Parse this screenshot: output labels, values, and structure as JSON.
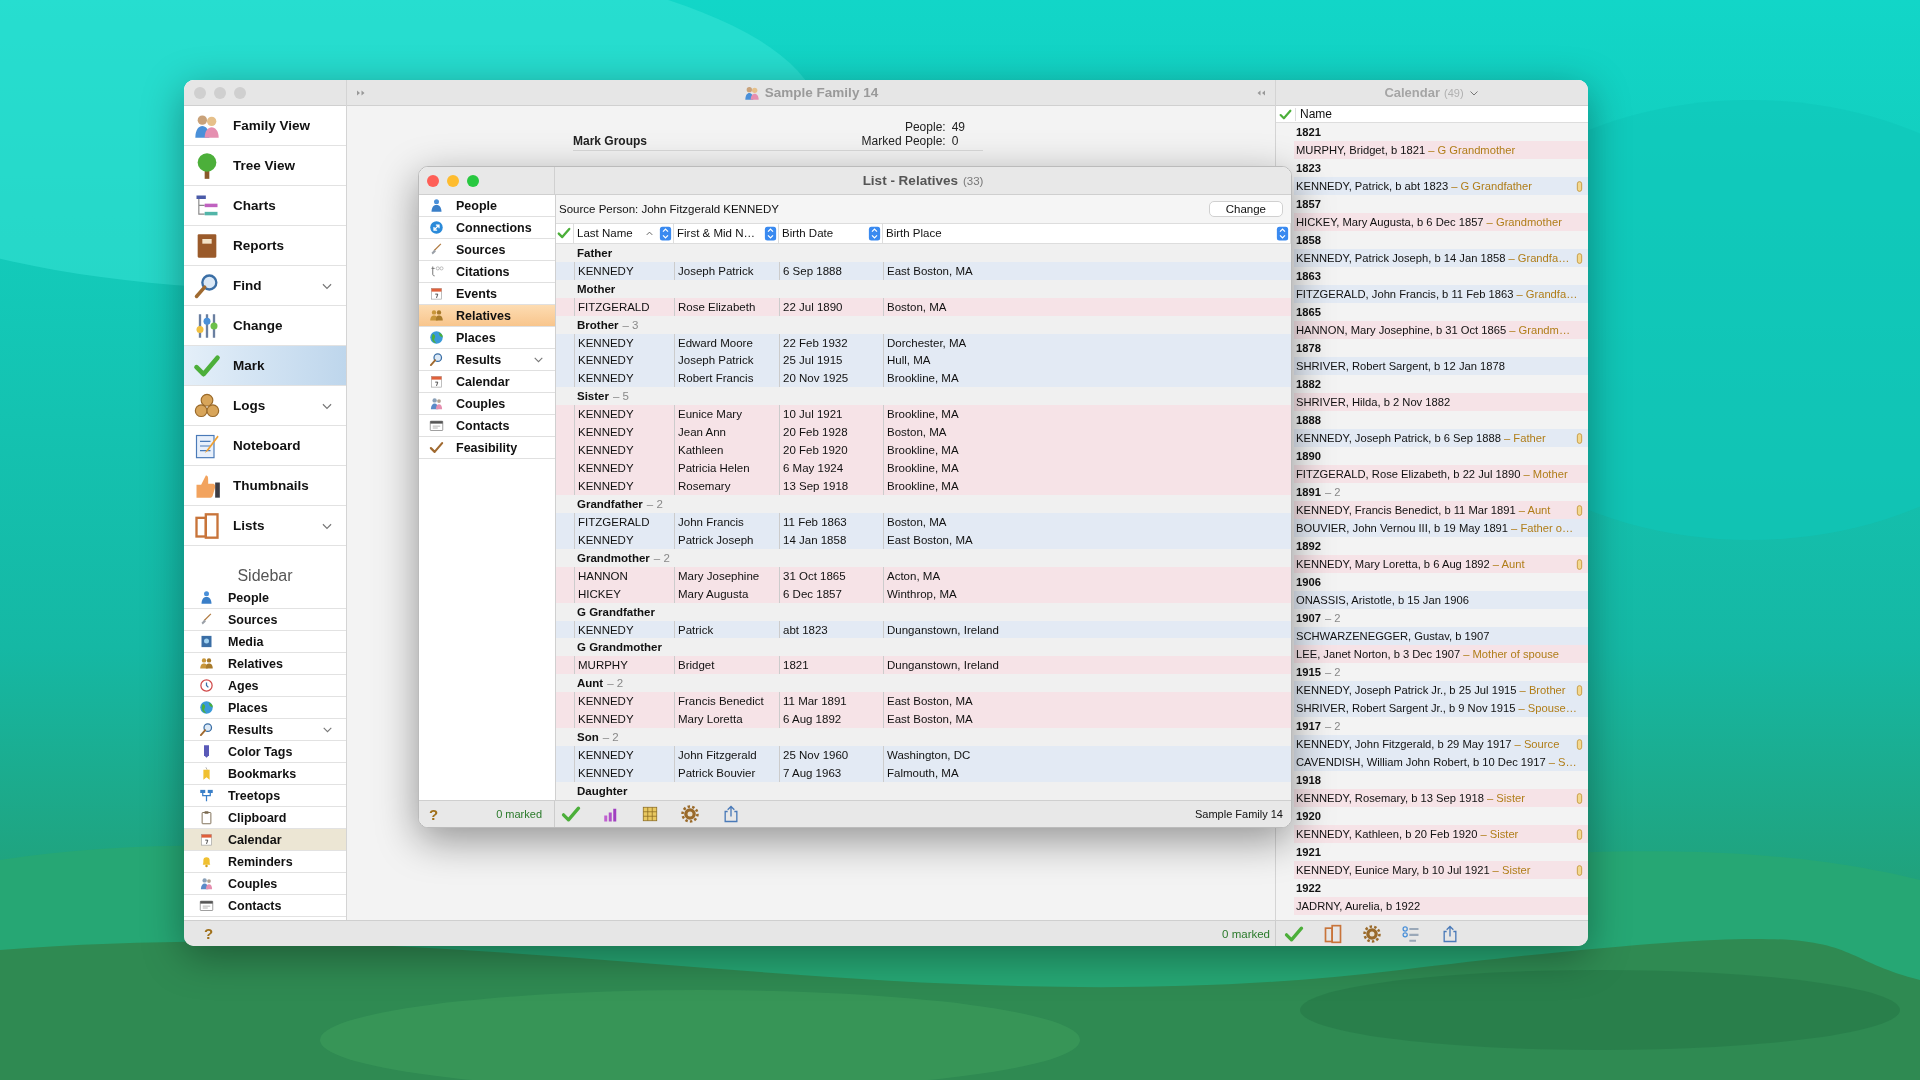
{
  "window": {
    "title": "Sample Family 14"
  },
  "nav": {
    "items": [
      {
        "label": "Family View",
        "selected": false,
        "expandable": false
      },
      {
        "label": "Tree View",
        "selected": false,
        "expandable": false
      },
      {
        "label": "Charts",
        "selected": false,
        "expandable": false
      },
      {
        "label": "Reports",
        "selected": false,
        "expandable": false
      },
      {
        "label": "Find",
        "selected": false,
        "expandable": true
      },
      {
        "label": "Change",
        "selected": false,
        "expandable": false
      },
      {
        "label": "Mark",
        "selected": true,
        "expandable": false
      },
      {
        "label": "Logs",
        "selected": false,
        "expandable": true
      },
      {
        "label": "Noteboard",
        "selected": false,
        "expandable": false
      },
      {
        "label": "Thumbnails",
        "selected": false,
        "expandable": false
      },
      {
        "label": "Lists",
        "selected": false,
        "expandable": true
      }
    ]
  },
  "sidebar": {
    "heading": "Sidebar",
    "items": [
      {
        "label": "People",
        "selected": false,
        "expandable": false
      },
      {
        "label": "Sources",
        "selected": false,
        "expandable": false
      },
      {
        "label": "Media",
        "selected": false,
        "expandable": false
      },
      {
        "label": "Relatives",
        "selected": false,
        "expandable": false
      },
      {
        "label": "Ages",
        "selected": false,
        "expandable": false
      },
      {
        "label": "Places",
        "selected": false,
        "expandable": false
      },
      {
        "label": "Results",
        "selected": false,
        "expandable": true
      },
      {
        "label": "Color Tags",
        "selected": false,
        "expandable": false
      },
      {
        "label": "Bookmarks",
        "selected": false,
        "expandable": false
      },
      {
        "label": "Treetops",
        "selected": false,
        "expandable": false
      },
      {
        "label": "Clipboard",
        "selected": false,
        "expandable": false
      },
      {
        "label": "Calendar",
        "selected": true,
        "expandable": false
      },
      {
        "label": "Reminders",
        "selected": false,
        "expandable": false
      },
      {
        "label": "Couples",
        "selected": false,
        "expandable": false
      },
      {
        "label": "Contacts",
        "selected": false,
        "expandable": false
      }
    ]
  },
  "mark_summary": {
    "heading": "Mark Groups",
    "stats": [
      {
        "label": "People:",
        "value": "49"
      },
      {
        "label": "Marked People:",
        "value": "0"
      }
    ]
  },
  "list_window": {
    "title": "List - Relatives",
    "count": "(33)",
    "menu": [
      {
        "label": "People",
        "selected": false,
        "expandable": false
      },
      {
        "label": "Connections",
        "selected": false,
        "expandable": false
      },
      {
        "label": "Sources",
        "selected": false,
        "expandable": false
      },
      {
        "label": "Citations",
        "selected": false,
        "expandable": false
      },
      {
        "label": "Events",
        "selected": false,
        "expandable": false
      },
      {
        "label": "Relatives",
        "selected": true,
        "expandable": false
      },
      {
        "label": "Places",
        "selected": false,
        "expandable": false
      },
      {
        "label": "Results",
        "selected": false,
        "expandable": true
      },
      {
        "label": "Calendar",
        "selected": false,
        "expandable": false
      },
      {
        "label": "Couples",
        "selected": false,
        "expandable": false
      },
      {
        "label": "Contacts",
        "selected": false,
        "expandable": false
      },
      {
        "label": "Feasibility",
        "selected": false,
        "expandable": false
      }
    ],
    "source_person": "Source Person: John Fitzgerald KENNEDY",
    "change_button": "Change",
    "columns": [
      {
        "label": "Last Name",
        "sorted": true
      },
      {
        "label": "First & Mid N…",
        "sorted": false
      },
      {
        "label": "Birth Date",
        "sorted": false
      },
      {
        "label": "Birth Place",
        "sorted": false
      }
    ],
    "rows": [
      {
        "kind": "group",
        "label": "Father"
      },
      {
        "kind": "person",
        "color": "#e3eaf4",
        "cells": [
          "KENNEDY",
          "Joseph Patrick",
          "6 Sep 1888",
          "East Boston, MA"
        ]
      },
      {
        "kind": "group",
        "label": "Mother"
      },
      {
        "kind": "person",
        "color": "#f6e3e7",
        "cells": [
          "FITZGERALD",
          "Rose Elizabeth",
          "22 Jul 1890",
          "Boston, MA"
        ]
      },
      {
        "kind": "group",
        "label": "Brother",
        "count": "– 3"
      },
      {
        "kind": "person",
        "color": "#e3eaf4",
        "cells": [
          "KENNEDY",
          "Edward Moore",
          "22 Feb 1932",
          "Dorchester, MA"
        ]
      },
      {
        "kind": "person",
        "color": "#e3eaf4",
        "cells": [
          "KENNEDY",
          "Joseph Patrick",
          "25 Jul 1915",
          "Hull, MA"
        ]
      },
      {
        "kind": "person",
        "color": "#e3eaf4",
        "cells": [
          "KENNEDY",
          "Robert Francis",
          "20 Nov 1925",
          "Brookline, MA"
        ]
      },
      {
        "kind": "group",
        "label": "Sister",
        "count": "– 5"
      },
      {
        "kind": "person",
        "color": "#f6e3e7",
        "cells": [
          "KENNEDY",
          "Eunice Mary",
          "10 Jul 1921",
          "Brookline, MA"
        ]
      },
      {
        "kind": "person",
        "color": "#f6e3e7",
        "cells": [
          "KENNEDY",
          "Jean Ann",
          "20 Feb 1928",
          "Boston, MA"
        ]
      },
      {
        "kind": "person",
        "color": "#f6e3e7",
        "cells": [
          "KENNEDY",
          "Kathleen",
          "20 Feb 1920",
          "Brookline, MA"
        ]
      },
      {
        "kind": "person",
        "color": "#f6e3e7",
        "cells": [
          "KENNEDY",
          "Patricia Helen",
          "6 May 1924",
          "Brookline, MA"
        ]
      },
      {
        "kind": "person",
        "color": "#f6e3e7",
        "cells": [
          "KENNEDY",
          "Rosemary",
          "13 Sep 1918",
          "Brookline, MA"
        ]
      },
      {
        "kind": "group",
        "label": "Grandfather",
        "count": "– 2"
      },
      {
        "kind": "person",
        "color": "#e3eaf4",
        "cells": [
          "FITZGERALD",
          "John Francis",
          "11 Feb 1863",
          "Boston, MA"
        ]
      },
      {
        "kind": "person",
        "color": "#e3eaf4",
        "cells": [
          "KENNEDY",
          "Patrick Joseph",
          "14 Jan 1858",
          "East Boston, MA"
        ]
      },
      {
        "kind": "group",
        "label": "Grandmother",
        "count": "– 2"
      },
      {
        "kind": "person",
        "color": "#f6e3e7",
        "cells": [
          "HANNON",
          "Mary Josephine",
          "31 Oct 1865",
          "Acton, MA"
        ]
      },
      {
        "kind": "person",
        "color": "#f6e3e7",
        "cells": [
          "HICKEY",
          "Mary Augusta",
          "6 Dec 1857",
          "Winthrop, MA"
        ]
      },
      {
        "kind": "group",
        "label": "G Grandfather"
      },
      {
        "kind": "person",
        "color": "#e3eaf4",
        "cells": [
          "KENNEDY",
          "Patrick",
          "abt 1823",
          "Dunganstown, Ireland"
        ]
      },
      {
        "kind": "group",
        "label": "G Grandmother"
      },
      {
        "kind": "person",
        "color": "#f6e3e7",
        "cells": [
          "MURPHY",
          "Bridget",
          "1821",
          "Dunganstown, Ireland"
        ]
      },
      {
        "kind": "group",
        "label": "Aunt",
        "count": "– 2"
      },
      {
        "kind": "person",
        "color": "#f6e3e7",
        "cells": [
          "KENNEDY",
          "Francis Benedict",
          "11 Mar 1891",
          "East Boston, MA"
        ]
      },
      {
        "kind": "person",
        "color": "#f6e3e7",
        "cells": [
          "KENNEDY",
          "Mary Loretta",
          "6 Aug 1892",
          "East Boston, MA"
        ]
      },
      {
        "kind": "group",
        "label": "Son",
        "count": "– 2"
      },
      {
        "kind": "person",
        "color": "#e3eaf4",
        "cells": [
          "KENNEDY",
          "John Fitzgerald",
          "25 Nov 1960",
          "Washington, DC"
        ]
      },
      {
        "kind": "person",
        "color": "#e3eaf4",
        "cells": [
          "KENNEDY",
          "Patrick Bouvier",
          "7 Aug 1963",
          "Falmouth, MA"
        ]
      },
      {
        "kind": "group",
        "label": "Daughter"
      }
    ],
    "footer": {
      "help": "?",
      "marked": "0 marked",
      "file": "Sample Family 14"
    }
  },
  "calendar": {
    "title": "Calendar",
    "count": "(49)",
    "column": "Name",
    "rows": [
      {
        "kind": "year",
        "label": "1821"
      },
      {
        "kind": "person",
        "color": "#f6e3e7",
        "text": "MURPHY, Bridget, b 1821",
        "relation": "– G Grandmother",
        "tagged": false
      },
      {
        "kind": "year",
        "label": "1823"
      },
      {
        "kind": "person",
        "color": "#e3eaf4",
        "text": "KENNEDY, Patrick, b abt 1823",
        "relation": "– G Grandfather",
        "tagged": true
      },
      {
        "kind": "year",
        "label": "1857"
      },
      {
        "kind": "person",
        "color": "#f6e3e7",
        "text": "HICKEY, Mary Augusta, b 6 Dec 1857",
        "relation": "– Grandmother",
        "tagged": false
      },
      {
        "kind": "year",
        "label": "1858"
      },
      {
        "kind": "person",
        "color": "#e3eaf4",
        "text": "KENNEDY, Patrick Joseph, b 14 Jan 1858",
        "relation": "– Grandfa…",
        "tagged": true
      },
      {
        "kind": "year",
        "label": "1863"
      },
      {
        "kind": "person",
        "color": "#e3eaf4",
        "text": "FITZGERALD, John Francis, b 11 Feb 1863",
        "relation": "– Grandfa…",
        "tagged": false
      },
      {
        "kind": "year",
        "label": "1865"
      },
      {
        "kind": "person",
        "color": "#f6e3e7",
        "text": "HANNON, Mary Josephine, b 31 Oct 1865",
        "relation": "– Grandm…",
        "tagged": false
      },
      {
        "kind": "year",
        "label": "1878"
      },
      {
        "kind": "person",
        "color": "#e3eaf4",
        "text": "SHRIVER, Robert Sargent, b 12 Jan 1878",
        "tagged": false
      },
      {
        "kind": "year",
        "label": "1882"
      },
      {
        "kind": "person",
        "color": "#f6e3e7",
        "text": "SHRIVER, Hilda, b 2 Nov 1882",
        "tagged": false
      },
      {
        "kind": "year",
        "label": "1888"
      },
      {
        "kind": "person",
        "color": "#e3eaf4",
        "text": "KENNEDY, Joseph Patrick, b 6 Sep 1888",
        "relation": "– Father",
        "tagged": true
      },
      {
        "kind": "year",
        "label": "1890"
      },
      {
        "kind": "person",
        "color": "#f6e3e7",
        "text": "FITZGERALD, Rose Elizabeth, b 22 Jul 1890",
        "relation": "– Mother",
        "tagged": false
      },
      {
        "kind": "year",
        "label": "1891",
        "count": "– 2"
      },
      {
        "kind": "person",
        "color": "#f6e3e7",
        "text": "KENNEDY, Francis Benedict, b 11 Mar 1891",
        "relation": "– Aunt",
        "tagged": true
      },
      {
        "kind": "person",
        "color": "#e3eaf4",
        "text": "BOUVIER, John Vernou III, b 19 May 1891",
        "relation": "– Father o…",
        "tagged": false
      },
      {
        "kind": "year",
        "label": "1892"
      },
      {
        "kind": "person",
        "color": "#f6e3e7",
        "text": "KENNEDY, Mary Loretta, b 6 Aug 1892",
        "relation": "– Aunt",
        "tagged": true
      },
      {
        "kind": "year",
        "label": "1906"
      },
      {
        "kind": "person",
        "color": "#e3eaf4",
        "text": "ONASSIS, Aristotle, b 15 Jan 1906",
        "tagged": false
      },
      {
        "kind": "year",
        "label": "1907",
        "count": "– 2"
      },
      {
        "kind": "person",
        "color": "#e3eaf4",
        "text": "SCHWARZENEGGER, Gustav, b 1907",
        "tagged": false
      },
      {
        "kind": "person",
        "color": "#f6e3e7",
        "text": "LEE, Janet Norton, b 3 Dec 1907",
        "relation": "– Mother of spouse",
        "tagged": false
      },
      {
        "kind": "year",
        "label": "1915",
        "count": "– 2"
      },
      {
        "kind": "person",
        "color": "#e3eaf4",
        "text": "KENNEDY, Joseph Patrick Jr., b 25 Jul 1915",
        "relation": "– Brother",
        "tagged": true
      },
      {
        "kind": "person",
        "color": "#e3eaf4",
        "text": "SHRIVER, Robert Sargent Jr., b 9 Nov 1915",
        "relation": "– Spouse…",
        "tagged": false
      },
      {
        "kind": "year",
        "label": "1917",
        "count": "– 2"
      },
      {
        "kind": "person",
        "color": "#e3eaf4",
        "text": "KENNEDY, John Fitzgerald, b 29 May 1917",
        "relation": "– Source",
        "tagged": true
      },
      {
        "kind": "person",
        "color": "#e3eaf4",
        "text": "CAVENDISH, William John Robert, b 10 Dec 1917",
        "relation": "– S…",
        "tagged": false
      },
      {
        "kind": "year",
        "label": "1918"
      },
      {
        "kind": "person",
        "color": "#f6e3e7",
        "text": "KENNEDY, Rosemary, b 13 Sep 1918",
        "relation": "– Sister",
        "tagged": true
      },
      {
        "kind": "year",
        "label": "1920"
      },
      {
        "kind": "person",
        "color": "#f6e3e7",
        "text": "KENNEDY, Kathleen, b 20 Feb 1920",
        "relation": "– Sister",
        "tagged": true
      },
      {
        "kind": "year",
        "label": "1921"
      },
      {
        "kind": "person",
        "color": "#f6e3e7",
        "text": "KENNEDY, Eunice Mary, b 10 Jul 1921",
        "relation": "– Sister",
        "tagged": true
      },
      {
        "kind": "year",
        "label": "1922"
      },
      {
        "kind": "person",
        "color": "#f6e3e7",
        "text": "JADRNY, Aurelia, b 1922",
        "tagged": false
      }
    ]
  },
  "status_bar": {
    "help": "?",
    "marked": "0 marked"
  }
}
